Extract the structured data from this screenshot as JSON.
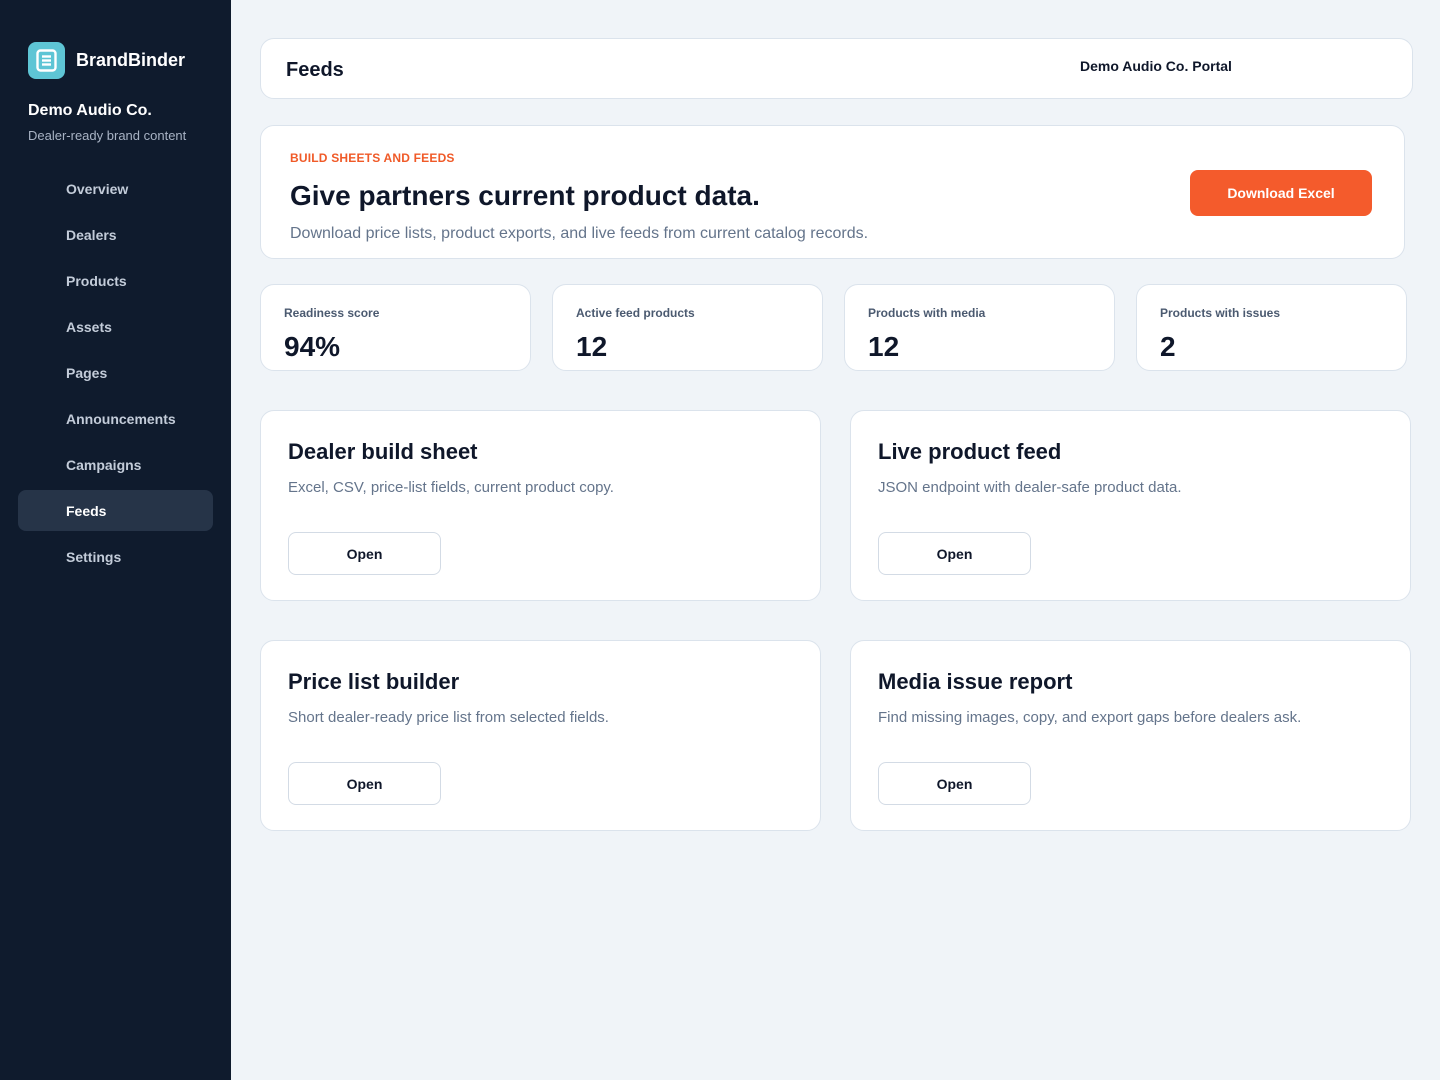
{
  "brand": {
    "name": "BrandBinder",
    "logo_icon": "document-list-icon",
    "logo_color": "#5ec5d5"
  },
  "org": {
    "name": "Demo Audio Co.",
    "tagline": "Dealer-ready brand content"
  },
  "nav": {
    "active": "Feeds",
    "items": [
      {
        "label": "Overview"
      },
      {
        "label": "Dealers"
      },
      {
        "label": "Products"
      },
      {
        "label": "Assets"
      },
      {
        "label": "Pages"
      },
      {
        "label": "Announcements"
      },
      {
        "label": "Campaigns"
      },
      {
        "label": "Feeds"
      },
      {
        "label": "Settings"
      }
    ]
  },
  "topbar": {
    "title": "Feeds",
    "portal": "Demo Audio Co. Portal"
  },
  "hero": {
    "eyebrow": "BUILD SHEETS AND FEEDS",
    "title": "Give partners current product data.",
    "description": "Download price lists, product exports, and live feeds from current catalog records.",
    "button_label": "Download Excel",
    "accent_color": "#f45b2c"
  },
  "stats": [
    {
      "label": "Readiness score",
      "value": "94%"
    },
    {
      "label": "Active feed products",
      "value": "12"
    },
    {
      "label": "Products with media",
      "value": "12"
    },
    {
      "label": "Products with issues",
      "value": "2"
    }
  ],
  "tools": [
    {
      "title": "Dealer build sheet",
      "description": "Excel, CSV, price-list fields, current product copy.",
      "button_label": "Open"
    },
    {
      "title": "Live product feed",
      "description": "JSON endpoint with dealer-safe product data.",
      "button_label": "Open"
    },
    {
      "title": "Price list builder",
      "description": "Short dealer-ready price list from selected fields.",
      "button_label": "Open"
    },
    {
      "title": "Media issue report",
      "description": "Find missing images, copy, and export gaps before dealers ask.",
      "button_label": "Open"
    }
  ]
}
